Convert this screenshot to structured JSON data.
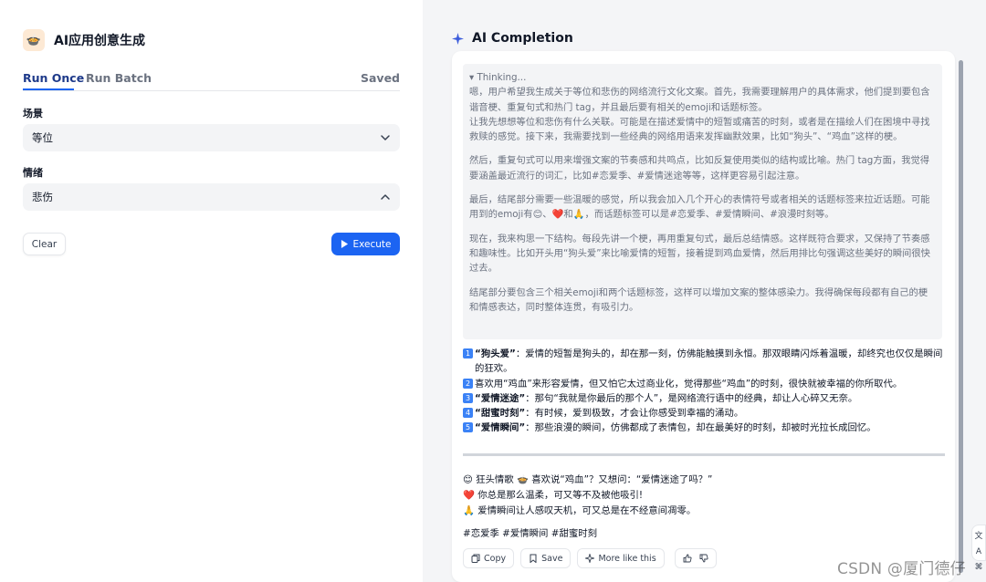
{
  "app": {
    "title": "AI应用创意生成"
  },
  "tabs": [
    {
      "label": "Run Once"
    },
    {
      "label": "Run Batch"
    }
  ],
  "saved_label": "Saved",
  "fields": [
    {
      "label": "场景",
      "value": "等位"
    },
    {
      "label": "情绪",
      "value": "悲伤"
    }
  ],
  "buttons": {
    "clear": "Clear",
    "execute": "Execute"
  },
  "completion": {
    "title": "AI Completion",
    "thinking_title": "▾ Thinking...",
    "thinking": [
      "嗯，用户希望我生成关于等位和悲伤的网络流行文化文案。首先，我需要理解用户的具体需求，他们提到要包含谐音梗、重复句式和热门 tag，并且最后要有相关的emoji和话题标签。\n让我先想想等位和悲伤有什么关联。可能是在描述爱情中的短暂或痛苦的时刻，或者是在描绘人们在困境中寻找救赎的感觉。接下来，我需要找到一些经典的网络用语来发挥幽默效果，比如“狗头”、“鸡血”这样的梗。",
      "然后，重复句式可以用来增强文案的节奏感和共鸣点，比如反复使用类似的结构或比喻。热门 tag方面，我觉得要涵盖最近流行的词汇，比如#恋爱季、#爱情迷途等等，这样更容易引起注意。",
      "最后，结尾部分需要一些温暖的感觉，所以我会加入几个开心的表情符号或者相关的话题标签来拉近话题。可能用到的emoji有😊、❤️和🙏，而话题标签可以是#恋爱季、#爱情瞬间、#浪漫时刻等。",
      "现在，我来构思一下结构。每段先讲一个梗，再用重复句式，最后总结情感。这样既符合要求，又保持了节奏感和趣味性。比如开头用“狗头爱”来比喻爱情的短暂，接着提到鸡血爱情，然后用排比句强调这些美好的瞬间很快过去。",
      "结尾部分要包含三个相关emoji和两个话题标签，这样可以增加文案的整体感染力。我得确保每段都有自己的梗和情感表达，同时整体连贯，有吸引力。"
    ],
    "items": [
      {
        "num": "1",
        "bold": "“狗头爱”",
        "text": "：爱情的短暂是狗头的，却在那一刻，仿佛能触摸到永恒。那双眼睛闪烁着温暖，却终究也仅仅是瞬间的狂欢。"
      },
      {
        "num": "2",
        "bold": "",
        "text": "喜欢用“鸡血”来形容爱情，但又怕它太过商业化，觉得那些“鸡血”的时刻，很快就被幸福的你所取代。"
      },
      {
        "num": "3",
        "bold": "“爱情迷途”",
        "text": "：那句“我就是你最后的那个人”，是网络流行语中的经典，却让人心碎又无奈。"
      },
      {
        "num": "4",
        "bold": "“甜蜜时刻”",
        "text": "：有时候，爱到极致，才会让你感受到幸福的涌动。"
      },
      {
        "num": "5",
        "bold": "“爱情瞬间”",
        "text": "：那些浪漫的瞬间，仿佛都成了表情包，却在最美好的时刻，却被时光拉长成回忆。"
      }
    ],
    "closing": [
      "😊 狂头情歌 🍲 喜欢说“鸡血”？又想问：“爱情迷途了吗？”",
      "❤️ 你总是那么温柔，可又等不及被他吸引!",
      "🙏 爱情瞬间让人感叹天机，可又总是在不经意间凋零。"
    ],
    "tags": "#恋爱季 #爱情瞬间 #甜蜜时刻",
    "actions": {
      "copy": "Copy",
      "save": "Save",
      "more": "More like this"
    }
  },
  "floating": {
    "top": "文A",
    "bottom": "⌘"
  },
  "watermark": "CSDN @厦门德仔"
}
